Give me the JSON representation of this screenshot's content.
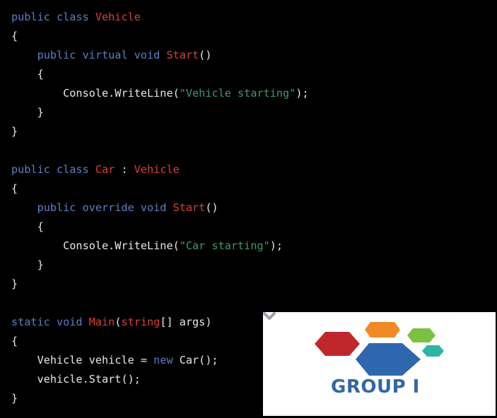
{
  "code": {
    "lines": [
      [
        {
          "t": "kw",
          "v": "public class "
        },
        {
          "t": "ty",
          "v": "Vehicle"
        }
      ],
      [
        {
          "t": "pl",
          "v": "{"
        }
      ],
      [
        {
          "t": "pl",
          "v": "    "
        },
        {
          "t": "kw",
          "v": "public virtual void "
        },
        {
          "t": "ty",
          "v": "Start"
        },
        {
          "t": "pl",
          "v": "()"
        }
      ],
      [
        {
          "t": "pl",
          "v": "    {"
        }
      ],
      [
        {
          "t": "pl",
          "v": "        Console.WriteLine("
        },
        {
          "t": "st",
          "v": "\"Vehicle starting\""
        },
        {
          "t": "pl",
          "v": ");"
        }
      ],
      [
        {
          "t": "pl",
          "v": "    }"
        }
      ],
      [
        {
          "t": "pl",
          "v": "}"
        }
      ],
      [],
      [
        {
          "t": "kw",
          "v": "public class "
        },
        {
          "t": "ty",
          "v": "Car"
        },
        {
          "t": "pl",
          "v": " : "
        },
        {
          "t": "ty",
          "v": "Vehicle"
        }
      ],
      [
        {
          "t": "pl",
          "v": "{"
        }
      ],
      [
        {
          "t": "pl",
          "v": "    "
        },
        {
          "t": "kw",
          "v": "public override void "
        },
        {
          "t": "ty",
          "v": "Start"
        },
        {
          "t": "pl",
          "v": "()"
        }
      ],
      [
        {
          "t": "pl",
          "v": "    {"
        }
      ],
      [
        {
          "t": "pl",
          "v": "        Console.WriteLine("
        },
        {
          "t": "st",
          "v": "\"Car starting\""
        },
        {
          "t": "pl",
          "v": ");"
        }
      ],
      [
        {
          "t": "pl",
          "v": "    }"
        }
      ],
      [
        {
          "t": "pl",
          "v": "}"
        }
      ],
      [],
      [
        {
          "t": "kw",
          "v": "static void "
        },
        {
          "t": "ty",
          "v": "Main"
        },
        {
          "t": "pl",
          "v": "("
        },
        {
          "t": "ty",
          "v": "string"
        },
        {
          "t": "pl",
          "v": "[] args)"
        }
      ],
      [
        {
          "t": "pl",
          "v": "{"
        }
      ],
      [
        {
          "t": "pl",
          "v": "    Vehicle vehicle = "
        },
        {
          "t": "kw",
          "v": "new"
        },
        {
          "t": "pl",
          "v": " Car();"
        }
      ],
      [
        {
          "t": "pl",
          "v": "    vehicle.Start();"
        }
      ],
      [
        {
          "t": "pl",
          "v": "}"
        }
      ]
    ]
  },
  "logo": {
    "text": "GROUP I",
    "icon": "hexagon-cluster-icon",
    "corner_icon": "chevron-down-icon"
  },
  "colors": {
    "background": "#000000",
    "keyword": "#5b7fc4",
    "type_name": "#d9403a",
    "plain": "#e8e8e8",
    "string": "#3d9b6a",
    "logo_text": "#3366a6",
    "hex_red": "#c0272d",
    "hex_orange": "#f08a24",
    "hex_green": "#7cc242",
    "hex_teal": "#2bb5a6",
    "hex_blue": "#2e67ad"
  }
}
